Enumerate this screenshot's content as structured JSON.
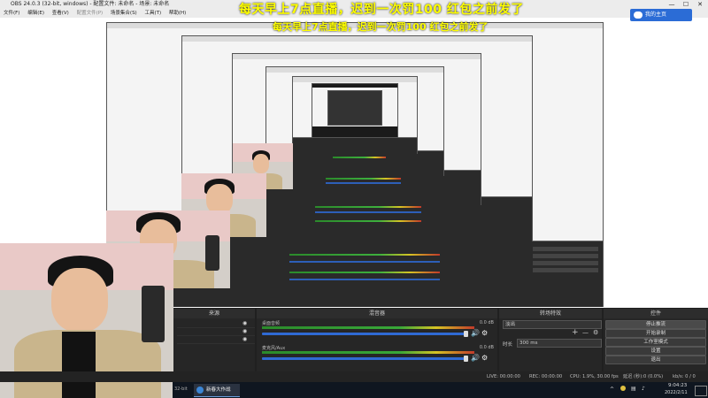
{
  "window": {
    "title": "OBS 24.0.3 (32-bit, windows) - 配置文件: 未命名 - 场景: 未命名",
    "controls": [
      "—",
      "☐",
      "✕"
    ]
  },
  "menu": [
    "文件(F)",
    "编辑(E)",
    "查看(V)",
    "配置文件(P)",
    "场景集合(S)",
    "工具(T)",
    "帮助(H)"
  ],
  "overlay_banner": "每天早上7点直播，迟到一次罚100   红包之前发了",
  "cloud_button": "我的主页",
  "nested_title": "OBS 24.0.3 (32-bit, windows) - 配置文件: 未命名 - 场景: 未命名",
  "panels": {
    "sources": "来源",
    "mixer": "混音器",
    "transitions": "转场特效",
    "controls": "控件"
  },
  "mixer": {
    "channels": [
      {
        "name": "桌面音频",
        "value": "0.0 dB"
      },
      {
        "name": "麦克风/Aux",
        "value": "0.0 dB"
      }
    ]
  },
  "transitions": {
    "selected": "淡出",
    "duration_label": "时长",
    "duration_value": "300 ms",
    "add": "+",
    "remove": "—",
    "gear": "⚙"
  },
  "controls": {
    "stop_stream": "停止推流",
    "start_record": "开始录制",
    "studio_mode": "工作室模式",
    "settings": "设置",
    "exit": "退出"
  },
  "status": {
    "live": "LIVE: 00:00:00",
    "rec": "REC: 00:00:00",
    "cpu": "CPU: 1.9%, 30.00 fps",
    "latency": "延迟 (秒):0 (0.0%)",
    "net": "kb/s: 0 / 0"
  },
  "taskbar": {
    "app": "新春大作战",
    "time": "9:04:23",
    "date": "2022/2/11",
    "segment": "32-bit"
  },
  "colors": {
    "accent": "#2f6ad4",
    "banner": "#ffff00",
    "panel": "#262626"
  }
}
